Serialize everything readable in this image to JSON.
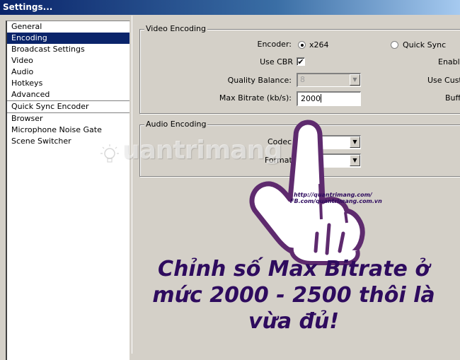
{
  "window": {
    "title": "Settings..."
  },
  "sidebar": {
    "items": [
      {
        "label": "General",
        "selected": false
      },
      {
        "label": "Encoding",
        "selected": true
      },
      {
        "label": "Broadcast Settings",
        "selected": false
      },
      {
        "label": "Video",
        "selected": false
      },
      {
        "label": "Audio",
        "selected": false
      },
      {
        "label": "Hotkeys",
        "selected": false
      },
      {
        "label": "Advanced",
        "selected": false
      },
      {
        "label": "Quick Sync Encoder",
        "selected": false
      },
      {
        "label": "Browser",
        "selected": false
      },
      {
        "label": "Microphone Noise Gate",
        "selected": false
      },
      {
        "label": "Scene Switcher",
        "selected": false
      }
    ]
  },
  "video_encoding": {
    "legend": "Video Encoding",
    "encoder_label": "Encoder:",
    "encoder_options": [
      {
        "label": "x264",
        "selected": true
      },
      {
        "label": "Quick Sync",
        "selected": false
      }
    ],
    "use_cbr_label": "Use CBR",
    "use_cbr_checked": true,
    "quality_balance_label": "Quality Balance:",
    "quality_balance_value": "8",
    "max_bitrate_label": "Max Bitrate (kb/s):",
    "max_bitrate_value": "2000",
    "right_col_enable_label": "Enable",
    "right_col_custom_label": "Use Custo",
    "right_col_buffer_label": "Buff"
  },
  "audio_encoding": {
    "legend": "Audio Encoding",
    "codec_label": "Codec",
    "format_label": "Format:"
  },
  "overlay": {
    "watermark": "uantrimang",
    "hand_url_1": "http://quantrimang.com/",
    "hand_url_2": "FB.com/quantrimang.com.vn",
    "caption": "Chỉnh số Max Bitrate ở mức 2000 - 2500 thôi là vừa đủ!",
    "caption_color": "#2e0b5e",
    "hand_outline_color": "#5e2a6e"
  },
  "icons": {
    "checkmark": "✔",
    "dropdown_arrow": "▼"
  }
}
